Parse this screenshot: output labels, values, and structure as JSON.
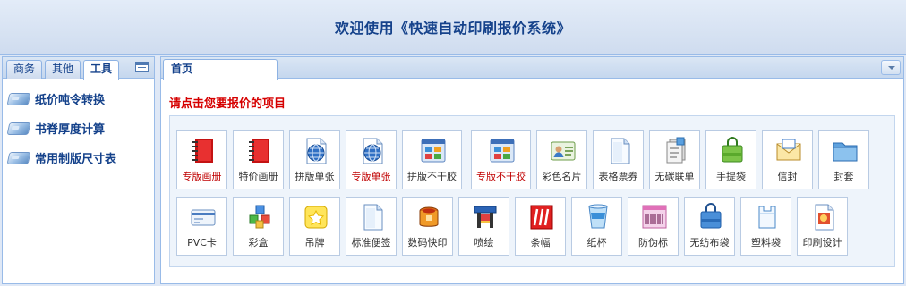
{
  "header": {
    "title": "欢迎使用《快速自动印刷报价系统》"
  },
  "west": {
    "tabs": [
      {
        "label": "商务"
      },
      {
        "label": "其他"
      },
      {
        "label": "工具"
      }
    ],
    "tool_icon": "list-icon",
    "items": [
      {
        "label": "纸价吨令转换"
      },
      {
        "label": "书脊厚度计算"
      },
      {
        "label": "常用制版尺寸表"
      }
    ]
  },
  "center": {
    "tab": {
      "label": "首页"
    },
    "prompt": "请点击您要报价的项目",
    "row1": [
      {
        "label": "专版画册",
        "icon": "red-notebook-icon",
        "highlight": true
      },
      {
        "label": "特价画册",
        "icon": "red-notebook-icon",
        "highlight": false
      },
      {
        "label": "拼版单张",
        "icon": "globe-document-icon",
        "highlight": false
      },
      {
        "label": "专版单张",
        "icon": "globe-document-icon",
        "highlight": true
      },
      {
        "label": "拼版不干胶",
        "icon": "window-grid-icon",
        "highlight": false
      },
      {
        "label": "专版不干胶",
        "icon": "window-grid-icon",
        "highlight": true
      },
      {
        "label": "彩色名片",
        "icon": "business-card-icon",
        "highlight": false
      },
      {
        "label": "表格票券",
        "icon": "blank-document-icon",
        "highlight": false
      },
      {
        "label": "无碳联单",
        "icon": "stacked-pages-icon",
        "highlight": false
      },
      {
        "label": "手提袋",
        "icon": "green-bag-icon",
        "highlight": false
      },
      {
        "label": "信封",
        "icon": "envelope-icon",
        "highlight": false
      },
      {
        "label": "封套",
        "icon": "folder-icon",
        "highlight": false
      }
    ],
    "row2": [
      {
        "label": "PVC卡",
        "icon": "card-icon"
      },
      {
        "label": "彩盒",
        "icon": "cubes-icon"
      },
      {
        "label": "吊牌",
        "icon": "tag-icon"
      },
      {
        "label": "标准便签",
        "icon": "blank-document-icon"
      },
      {
        "label": "数码快印",
        "icon": "paint-bucket-icon"
      },
      {
        "label": "喷绘",
        "icon": "printer-icon"
      },
      {
        "label": "条幅",
        "icon": "banner-icon"
      },
      {
        "label": "纸杯",
        "icon": "paper-cup-icon"
      },
      {
        "label": "防伪标",
        "icon": "barcode-icon"
      },
      {
        "label": "无纺布袋",
        "icon": "blue-bag-icon"
      },
      {
        "label": "塑料袋",
        "icon": "plastic-bag-icon"
      },
      {
        "label": "印刷设计",
        "icon": "design-document-icon"
      }
    ]
  }
}
